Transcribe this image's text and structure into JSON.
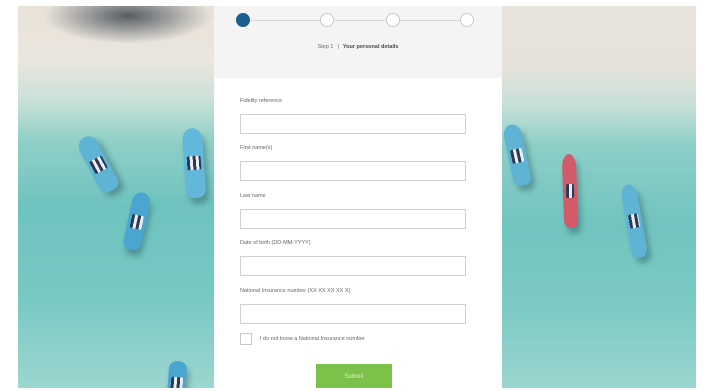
{
  "stepper": {
    "steps": 4,
    "active_step": 1,
    "step_text": "Step 1",
    "separator": "|",
    "step_name": "Your personal details"
  },
  "form": {
    "fields": [
      {
        "label": "Fidelity reference",
        "value": ""
      },
      {
        "label": "First name(s)",
        "value": ""
      },
      {
        "label": "Last name",
        "value": ""
      },
      {
        "label": "Date of birth (DD-MM-YYYY)",
        "value": ""
      },
      {
        "label": "National Insurance number (XX XX XX XX X)",
        "value": ""
      }
    ],
    "checkbox_label": "I do not know a National Insurance number",
    "checkbox_checked": false,
    "submit_label": "Submit"
  },
  "colors": {
    "active_step": "#1d5f8f",
    "submit_button": "#7cc24a"
  }
}
